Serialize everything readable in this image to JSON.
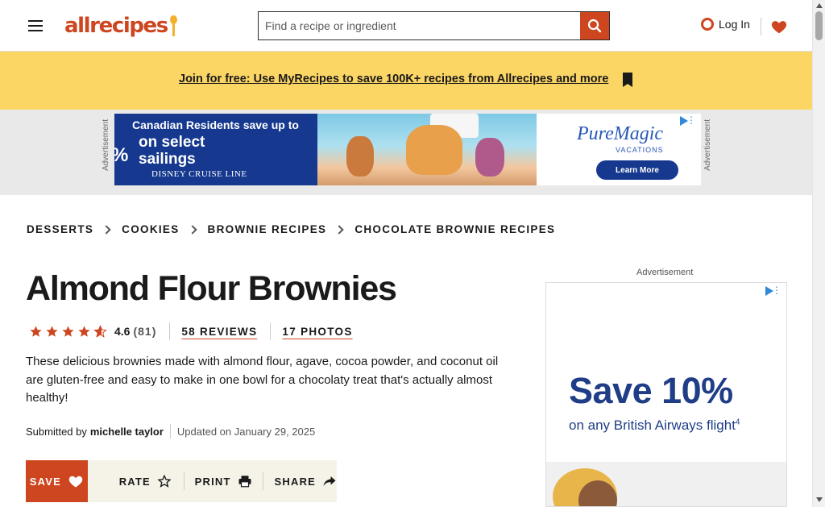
{
  "header": {
    "logo_text": "allrecipes",
    "search_placeholder": "Find a recipe or ingredient",
    "login_label": "Log In"
  },
  "promo": {
    "link_text": "Join for free: Use MyRecipes to save 100K+ recipes from Allrecipes and more"
  },
  "ad_banner": {
    "label": "Advertisement",
    "headline_1": "Canadian Residents save up to",
    "headline_2": "on select",
    "headline_3": "sailings",
    "percent_fragment": "%",
    "brand_left": "DISNEY CRUISE LINE",
    "brand_right": "PureMagic",
    "brand_right_sub": "VACATIONS",
    "cta": "Learn More"
  },
  "breadcrumbs": [
    "DESSERTS",
    "COOKIES",
    "BROWNIE RECIPES",
    "CHOCOLATE BROWNIE RECIPES"
  ],
  "recipe": {
    "title": "Almond Flour Brownies",
    "rating_value": "4.6",
    "rating_count": "(81)",
    "stars": 4.6,
    "reviews_link": "58 REVIEWS",
    "photos_link": "17 PHOTOS",
    "description": "These delicious brownies made with almond flour, agave, cocoa powder, and coconut oil are gluten-free and easy to make in one bowl for a chocolaty treat that's actually almost healthy!",
    "submitted_by_label": "Submitted by",
    "author": "michelle taylor",
    "updated": "Updated on January 29, 2025"
  },
  "actions": {
    "save": "SAVE",
    "rate": "RATE",
    "print": "PRINT",
    "share": "SHARE"
  },
  "side_ad": {
    "label": "Advertisement",
    "headline": "Save 10%",
    "subline": "on any British Airways flight",
    "footnote": "4"
  },
  "colors": {
    "brand": "#ce4620",
    "promo_bg": "#fcd664",
    "ad_band_bg": "#e9e9e9",
    "actions_bg": "#f5f3e8"
  }
}
